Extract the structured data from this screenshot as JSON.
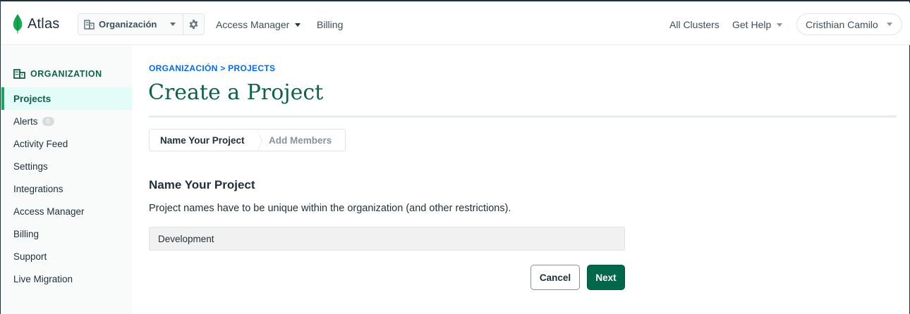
{
  "header": {
    "logo_text": "Atlas",
    "org_selector": {
      "label": "Organización"
    },
    "nav": {
      "access_manager": "Access Manager",
      "billing": "Billing",
      "all_clusters": "All Clusters",
      "get_help": "Get Help"
    },
    "user": {
      "name": "Cristhian Camilo"
    }
  },
  "sidebar": {
    "section_title": "ORGANIZATION",
    "items": [
      {
        "label": "Projects",
        "active": true
      },
      {
        "label": "Alerts",
        "badge": "0"
      },
      {
        "label": "Activity Feed"
      },
      {
        "label": "Settings"
      },
      {
        "label": "Integrations"
      },
      {
        "label": "Access Manager"
      },
      {
        "label": "Billing"
      },
      {
        "label": "Support"
      },
      {
        "label": "Live Migration"
      }
    ]
  },
  "main": {
    "breadcrumb": "ORGANIZACIÓN > PROJECTS",
    "title": "Create a Project",
    "steps": [
      {
        "label": "Name Your Project",
        "state": "current"
      },
      {
        "label": "Add Members",
        "state": "upcoming"
      }
    ],
    "section_title": "Name Your Project",
    "section_desc": "Project names have to be unique within the organization (and other restrictions).",
    "project_name_value": "Development",
    "buttons": {
      "cancel": "Cancel",
      "next": "Next"
    }
  },
  "colors": {
    "brand_green": "#116149",
    "primary_button": "#00684a",
    "link_blue": "#016bf8",
    "active_nav_bg": "#e3fcf7",
    "active_nav_bar": "#13aa52"
  },
  "icons": {
    "logo": "leaf-icon",
    "org": "building-icon",
    "settings": "gear-icon",
    "dropdown": "caret-down-icon"
  }
}
